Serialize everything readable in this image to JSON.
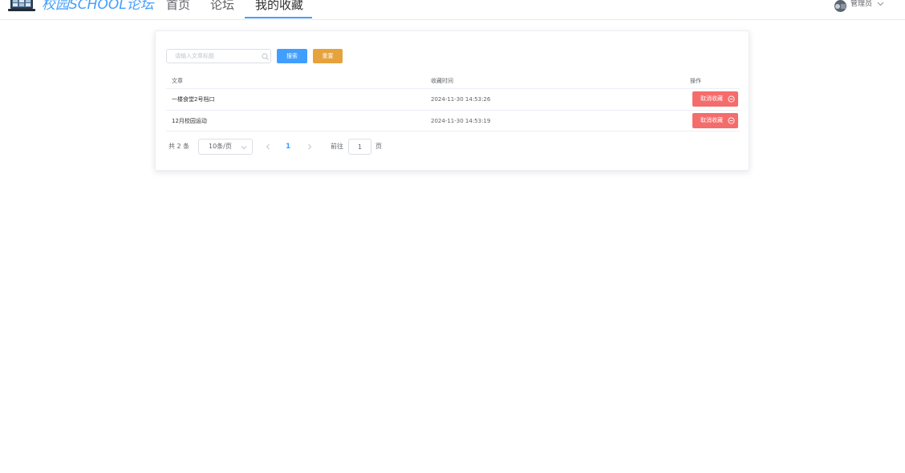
{
  "header": {
    "brand": "校园SCHOOL论坛",
    "nav": [
      {
        "label": "首页"
      },
      {
        "label": "论坛"
      },
      {
        "label": "我的收藏"
      }
    ],
    "user_name": "管理员"
  },
  "search": {
    "placeholder": "请输入文章标题",
    "search_label": "搜索",
    "reset_label": "重置"
  },
  "table": {
    "columns": [
      "文章",
      "收藏时间",
      "操作"
    ],
    "rows": [
      {
        "title": "一楼食堂2号档口",
        "time": "2024-11-30 14:53:26",
        "action": "取消收藏"
      },
      {
        "title": "12月校园运动",
        "time": "2024-11-30 14:53:19",
        "action": "取消收藏"
      }
    ]
  },
  "pagination": {
    "total": "共 2 条",
    "page_size": "10条/页",
    "current": "1",
    "goto_label": "前往",
    "goto_value": "1",
    "page_suffix": "页"
  },
  "colors": {
    "primary": "#409eff",
    "warning": "#e6a23c",
    "danger": "#f56c6c"
  }
}
